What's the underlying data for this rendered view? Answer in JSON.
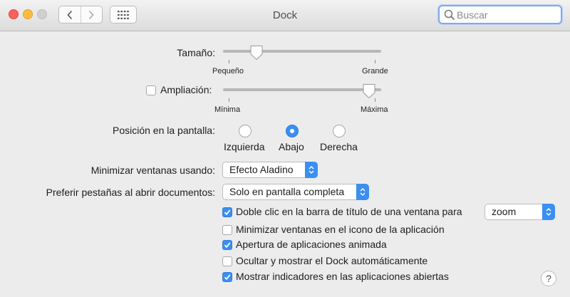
{
  "window": {
    "title": "Dock"
  },
  "search": {
    "placeholder": "Buscar",
    "value": ""
  },
  "size": {
    "label": "Tamaño:",
    "min_label": "Pequeño",
    "max_label": "Grande",
    "value_fraction": 0.19
  },
  "magnification": {
    "label": "Ampliación:",
    "checked": false,
    "min_label": "Mínima",
    "max_label": "Máxima",
    "value_fraction": 0.96
  },
  "position": {
    "label": "Posición en la pantalla:",
    "options": [
      "Izquierda",
      "Abajo",
      "Derecha"
    ],
    "selected": "Abajo"
  },
  "minimize": {
    "label": "Minimizar ventanas usando:",
    "value": "Efecto Aladino"
  },
  "tabs": {
    "label": "Preferir pestañas al abrir documentos:",
    "value": "Solo en pantalla completa"
  },
  "double_click": {
    "label": "Doble clic en la barra de título de una ventana para",
    "checked": true,
    "value": "zoom"
  },
  "checkboxes": [
    {
      "label": "Minimizar ventanas en el icono de la aplicación",
      "checked": false
    },
    {
      "label": "Apertura de aplicaciones animada",
      "checked": true
    },
    {
      "label": "Ocultar y mostrar el Dock automáticamente",
      "checked": false
    },
    {
      "label": "Mostrar indicadores en las aplicaciones abiertas",
      "checked": true
    }
  ],
  "help": {
    "label": "?"
  },
  "colors": {
    "accent": "#3b8ef2",
    "close": "#fc605c",
    "minimize": "#fdbc40"
  }
}
